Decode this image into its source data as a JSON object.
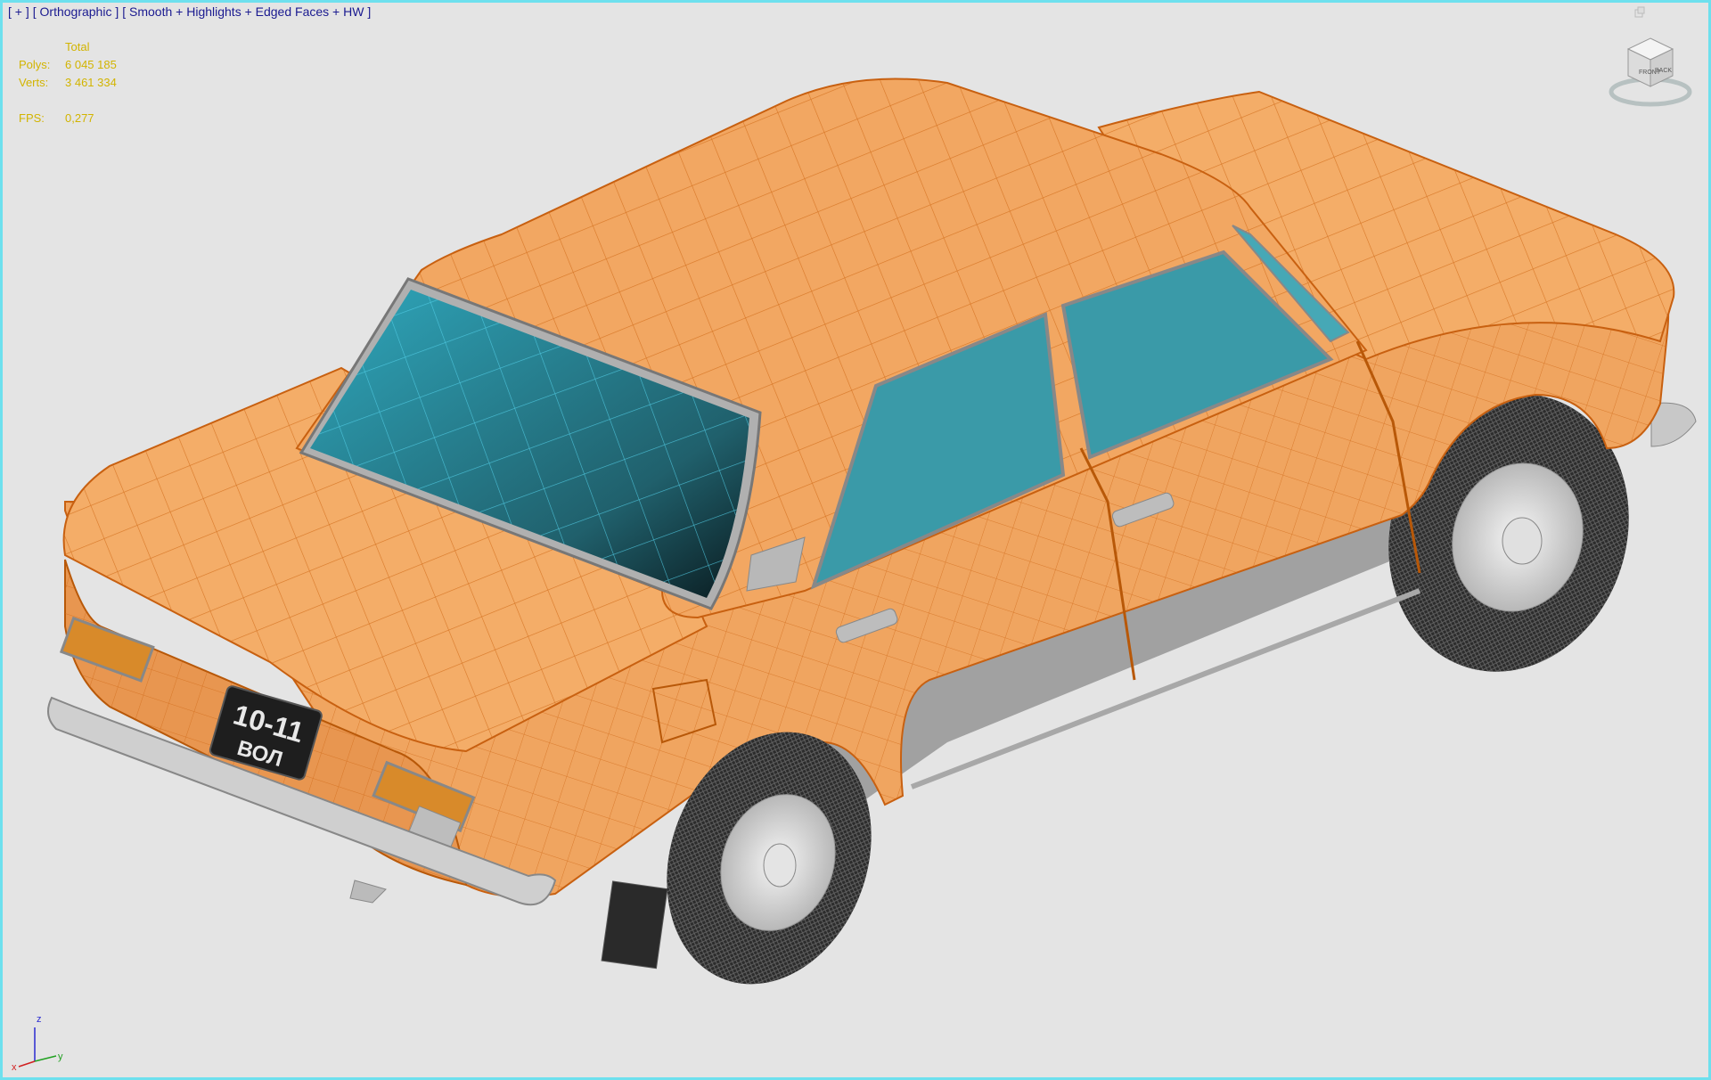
{
  "viewport": {
    "menu": {
      "plus": "[ + ]",
      "view": "[ Orthographic ]",
      "shading": "[ Smooth + Highlights + Edged Faces + HW ]"
    },
    "stats": {
      "header": "Total",
      "polys_label": "Polys:",
      "polys_value": "6 045 185",
      "verts_label": "Verts:",
      "verts_value": "3 461 334",
      "fps_label": "FPS:",
      "fps_value": "0,277"
    },
    "viewcube": {
      "icon": "viewcube-icon",
      "front_label": "FRONT",
      "side_label": "BACK"
    },
    "axis": {
      "x": "x",
      "y": "y",
      "z": "z"
    },
    "model": {
      "plate_line1": "10-11",
      "plate_line2": "ВОЛ",
      "body_color": "#f0a560",
      "wire_color": "#d86a10",
      "glass_color": "#3a9aa8"
    }
  }
}
